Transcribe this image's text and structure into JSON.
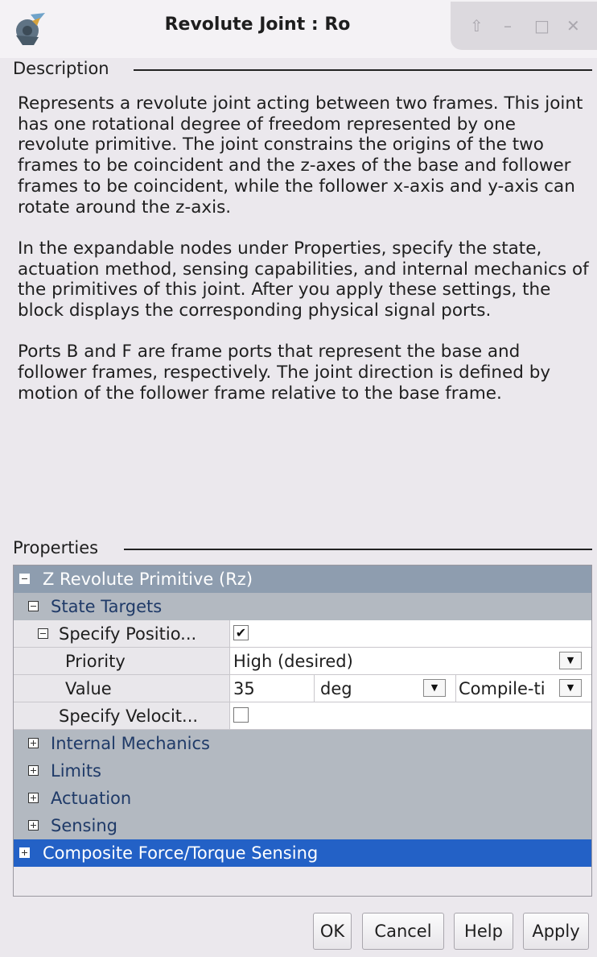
{
  "window": {
    "title": "Revolute Joint : Ro",
    "icons": [
      "app-block-icon",
      "shade-up-icon",
      "minimize-icon",
      "maximize-icon",
      "close-icon"
    ]
  },
  "description": {
    "label": "Description",
    "paragraphs": [
      "Represents a revolute joint acting between two frames. This joint has one rotational degree of freedom represented by one revolute primitive. The joint constrains the origins of the two frames to be coincident and the z-axes of the base and follower frames to be coincident, while the follower x-axis and y-axis can rotate around the z-axis.",
      "In the expandable nodes under Properties, specify the state, actuation method, sensing capabilities, and internal mechanics of the primitives of this joint. After you apply these settings, the block displays the corresponding physical signal ports.",
      "Ports B and F are frame ports that represent the base and follower frames, respectively. The joint direction is defined by motion of the follower frame relative to the base frame."
    ]
  },
  "properties": {
    "label": "Properties",
    "primitive": "Z Revolute Primitive (Rz)",
    "state_targets": "State Targets",
    "specify_position": {
      "label": "Specify Positio...",
      "checked": true
    },
    "priority": {
      "label": "Priority",
      "value": "High (desired)"
    },
    "value": {
      "label": "Value",
      "amount": "35",
      "unit": "deg",
      "mode": "Compile-ti"
    },
    "specify_velocity": {
      "label": "Specify Velocit...",
      "checked": false
    },
    "internal_mechanics": "Internal Mechanics",
    "limits": "Limits",
    "actuation": "Actuation",
    "sensing": "Sensing",
    "composite_sensing": "Composite Force/Torque Sensing"
  },
  "buttons": {
    "ok": "OK",
    "cancel": "Cancel",
    "help": "Help",
    "apply": "Apply"
  },
  "colors": {
    "selected_row": "#2361c6",
    "top_node": "#8e9daf",
    "sub_node": "#b3b9c1",
    "sub_node_text": "#1f3a68"
  }
}
